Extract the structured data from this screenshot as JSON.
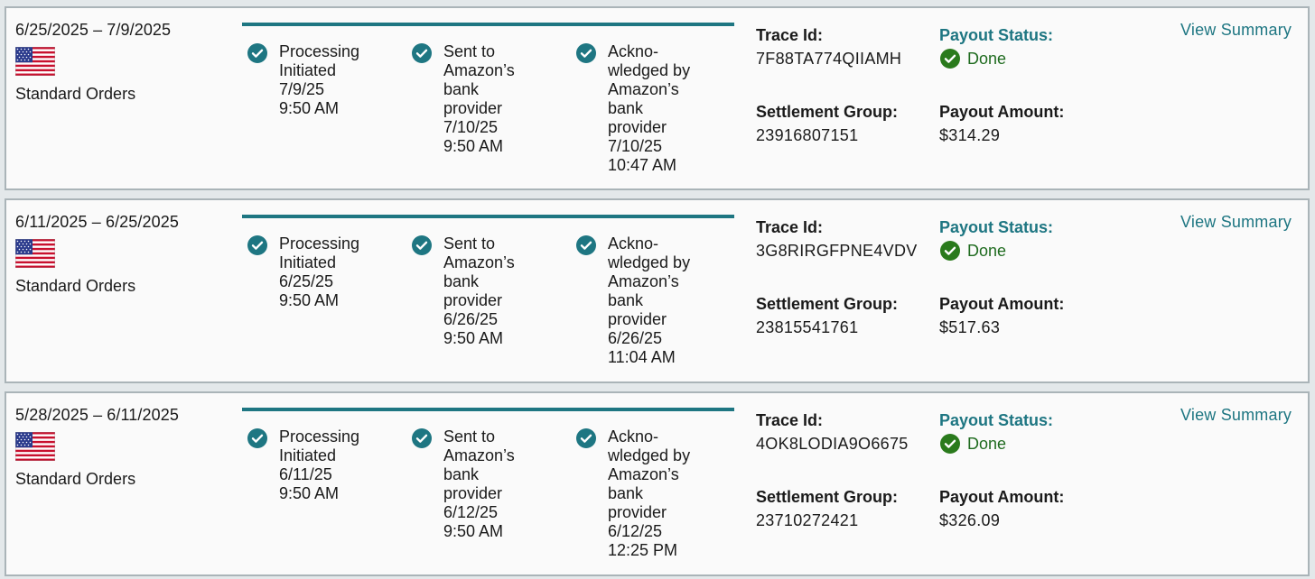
{
  "labels": {
    "trace_id": "Trace Id:",
    "settlement_group": "Settlement Group:",
    "payout_status": "Payout Status:",
    "payout_amount": "Payout Amount:",
    "view_summary": "View Summary",
    "order_type": "Standard Orders"
  },
  "colors": {
    "accent": "#1e7682",
    "done": "#1f6b1f"
  },
  "icons": {
    "flag": "us-flag-icon",
    "step_check": "teal-check-circle-icon",
    "status_check": "green-check-circle-icon"
  },
  "payouts": [
    {
      "date_range": "6/25/2025 – 7/9/2025",
      "steps": [
        {
          "lines": [
            "Processing",
            "Initiated",
            "7/9/25",
            "9:50 AM"
          ]
        },
        {
          "lines": [
            "Sent to",
            "Amazon’s",
            "bank provider",
            "7/10/25",
            "9:50 AM"
          ]
        },
        {
          "lines": [
            "Ackno-",
            "wledged by",
            "Amazon’s",
            "bank provider",
            "7/10/25",
            "10:47 AM"
          ]
        }
      ],
      "trace_id": "7F88TA774QIIAMH",
      "settlement_group": "23916807151",
      "status": "Done",
      "amount": "$314.29"
    },
    {
      "date_range": "6/11/2025 – 6/25/2025",
      "steps": [
        {
          "lines": [
            "Processing",
            "Initiated",
            "6/25/25",
            "9:50 AM"
          ]
        },
        {
          "lines": [
            "Sent to",
            "Amazon’s",
            "bank provider",
            "6/26/25",
            "9:50 AM"
          ]
        },
        {
          "lines": [
            "Ackno-",
            "wledged by",
            "Amazon’s",
            "bank provider",
            "6/26/25",
            "11:04 AM"
          ]
        }
      ],
      "trace_id": "3G8RIRGFPNE4VDV",
      "settlement_group": "23815541761",
      "status": "Done",
      "amount": "$517.63"
    },
    {
      "date_range": "5/28/2025 – 6/11/2025",
      "steps": [
        {
          "lines": [
            "Processing",
            "Initiated",
            "6/11/25",
            "9:50 AM"
          ]
        },
        {
          "lines": [
            "Sent to",
            "Amazon’s",
            "bank provider",
            "6/12/25",
            "9:50 AM"
          ]
        },
        {
          "lines": [
            "Ackno-",
            "wledged by",
            "Amazon’s",
            "bank provider",
            "6/12/25",
            "12:25 PM"
          ]
        }
      ],
      "trace_id": "4OK8LODIA9O6675",
      "settlement_group": "23710272421",
      "status": "Done",
      "amount": "$326.09"
    }
  ]
}
